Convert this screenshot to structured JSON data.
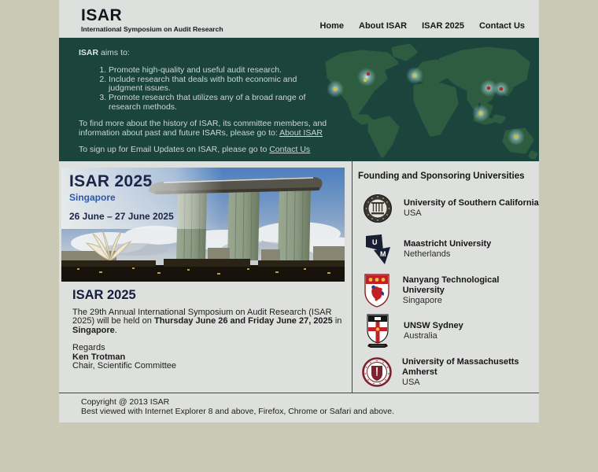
{
  "header": {
    "logo_title": "ISAR",
    "logo_subtitle": "International Symposium on Audit Research",
    "nav": [
      {
        "label": "Home"
      },
      {
        "label": "About ISAR"
      },
      {
        "label": "ISAR 2025"
      },
      {
        "label": "Contact Us"
      }
    ]
  },
  "banner": {
    "intro_bold": "ISAR",
    "intro_rest": " aims to:",
    "aims": [
      "Promote high-quality and useful audit research.",
      "Include research that deals with both economic and judgment issues.",
      "Promote research that utilizes any of a broad range of research methods."
    ],
    "history_text": "To find more about the history of ISAR, its committee members, and information about past and future ISARs, please go to: ",
    "history_link_label": "About ISAR",
    "signup_text": "To sign up for Email Updates on ISAR, please go to ",
    "signup_link_label": "Contact Us"
  },
  "hero": {
    "title": "ISAR 2025",
    "location": "Singapore",
    "dates": "26 June – 27 June 2025"
  },
  "announcement": {
    "heading": "ISAR 2025",
    "body_start": "The 29th Annual International Symposium on Audit Research (ISAR 2025) will be held on ",
    "body_bold_dates": "Thursday June 26 and Friday June 27, 2025",
    "body_middle": " in ",
    "body_bold_place": "Singapore",
    "body_end": ".",
    "regards": "Regards",
    "chair_name": "Ken Trotman",
    "chair_title": "Chair, Scientific Committee"
  },
  "sponsors": {
    "heading": "Founding and Sponsoring Universities",
    "universities": [
      {
        "name": "University of Southern California",
        "country": "USA",
        "logo_icon": "usc-seal-icon"
      },
      {
        "name": "Maastricht University",
        "country": "Netherlands",
        "logo_icon": "maastricht-logo-icon"
      },
      {
        "name": "Nanyang Technological University",
        "country": "Singapore",
        "logo_icon": "ntu-crest-icon"
      },
      {
        "name": "UNSW Sydney",
        "country": "Australia",
        "logo_icon": "unsw-crest-icon"
      },
      {
        "name": "University of Massachusetts Amherst",
        "country": "USA",
        "logo_icon": "umass-seal-icon"
      }
    ]
  },
  "footer": {
    "line1": "Copyright @ 2013 ISAR",
    "line2": "Best viewed with Internet Explorer 8 and above, Firefox, Chrome or Safari and above."
  },
  "colors": {
    "page_bg": "#c9c9b5",
    "content_bg": "#dee0dd",
    "banner_bg": "#1b443d",
    "map_land": "#2e5c40",
    "banner_text": "#ccd6d2",
    "accent_navy": "#1b2547",
    "accent_blue": "#2b57ad",
    "divider": "#40474e"
  }
}
